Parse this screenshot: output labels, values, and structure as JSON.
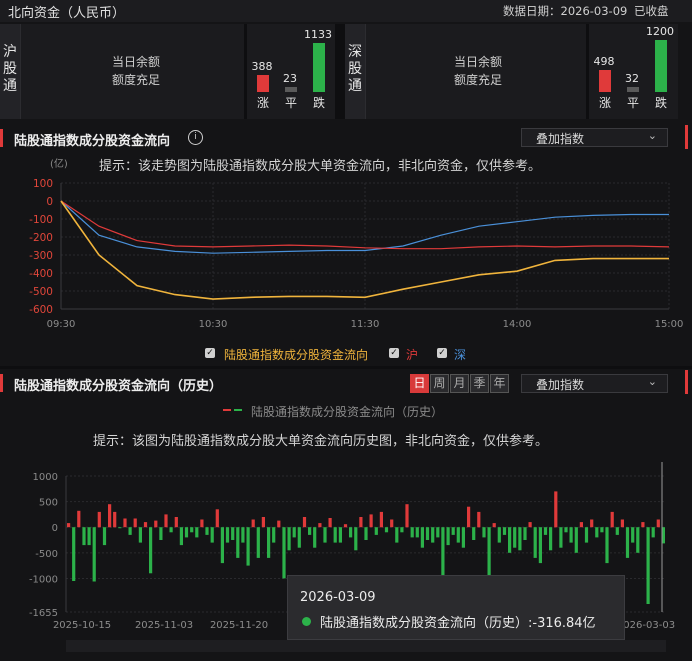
{
  "header": {
    "title": "北向资金（人民币）",
    "date_label": "数据日期：2026-03-09",
    "status": "已收盘"
  },
  "sh": {
    "name_chars": [
      "沪",
      "股",
      "通"
    ],
    "quota_title": "当日余额",
    "quota_status": "额度充足",
    "up": 388,
    "flat": 23,
    "down": 1133,
    "up_label": "涨",
    "flat_label": "平",
    "down_label": "跌"
  },
  "sz": {
    "name_chars": [
      "深",
      "股",
      "通"
    ],
    "quota_title": "当日余额",
    "quota_status": "额度充足",
    "up": 498,
    "flat": 32,
    "down": 1200,
    "up_label": "涨",
    "flat_label": "平",
    "down_label": "跌"
  },
  "intraday": {
    "title": "陆股通指数成分股资金流向",
    "info_icon": "info-icon",
    "dropdown": "叠加指数",
    "hint": "提示：该走势图为陆股通指数成分股大单资金流向，非北向资金，仅供参考。",
    "unit": "(亿)",
    "legend": [
      {
        "label": "陆股通指数成分股资金流向",
        "color": "#f0b43c"
      },
      {
        "label": "沪",
        "color": "#e03a3a"
      },
      {
        "label": "深",
        "color": "#4a90d9"
      }
    ]
  },
  "history": {
    "title": "陆股通指数成分股资金流向（历史）",
    "period_buttons": [
      "日",
      "周",
      "月",
      "季",
      "年"
    ],
    "active_period": 0,
    "dropdown": "叠加指数",
    "legend_label": "陆股通指数成分股资金流向（历史）",
    "hint": "提示：该图为陆股通指数成分股大单资金流向历史图，非北向资金，仅供参考。",
    "tooltip_date": "2026-03-09",
    "tooltip_text": "陆股通指数成分股资金流向（历史）:-316.84亿"
  },
  "colors": {
    "up": "#e03a3a",
    "down": "#2cb24a",
    "total": "#f0b43c",
    "sh": "#e03a3a",
    "sz": "#4a90d9",
    "axis_red": "#e0463a"
  },
  "chart_data": [
    {
      "type": "line",
      "title": "陆股通指数成分股资金流向",
      "ylabel": "(亿)",
      "x": [
        "09:30",
        "09:45",
        "10:00",
        "10:15",
        "10:30",
        "10:45",
        "11:00",
        "11:15",
        "11:30",
        "13:15",
        "13:30",
        "13:45",
        "14:00",
        "14:15",
        "14:30",
        "14:45",
        "15:00"
      ],
      "xticks": [
        "09:30",
        "10:30",
        "11:30",
        "14:00",
        "15:00"
      ],
      "yticks": [
        100,
        0,
        -100,
        -200,
        -300,
        -400,
        -500,
        -600
      ],
      "ylim": [
        -600,
        100
      ],
      "series": [
        {
          "name": "陆股通指数成分股资金流向",
          "values": [
            0,
            -300,
            -470,
            -520,
            -545,
            -535,
            -530,
            -530,
            -535,
            -490,
            -450,
            -410,
            -390,
            -330,
            -320,
            -320,
            -320
          ]
        },
        {
          "name": "沪",
          "values": [
            0,
            -140,
            -220,
            -250,
            -255,
            -250,
            -245,
            -250,
            -260,
            -265,
            -265,
            -255,
            -250,
            -255,
            -250,
            -250,
            -255
          ]
        },
        {
          "name": "深",
          "values": [
            0,
            -190,
            -255,
            -280,
            -290,
            -285,
            -280,
            -275,
            -275,
            -250,
            -190,
            -140,
            -115,
            -90,
            -80,
            -75,
            -75
          ]
        }
      ],
      "grid": true
    },
    {
      "type": "bar",
      "title": "陆股通指数成分股资金流向（历史）",
      "yticks": [
        1000,
        500,
        0,
        -500,
        -1000,
        -1655
      ],
      "ylim": [
        -1655,
        1000
      ],
      "xticks": [
        "2025-10-15",
        "2025-11-03",
        "2025-11-20",
        "2026-03-03"
      ],
      "values": [
        80,
        -1050,
        320,
        -350,
        -350,
        -1060,
        300,
        -350,
        450,
        300,
        -1,
        170,
        -150,
        170,
        -300,
        100,
        -900,
        130,
        -250,
        250,
        -100,
        200,
        -350,
        -200,
        -100,
        -200,
        150,
        -150,
        -300,
        350,
        -700,
        -300,
        -250,
        -600,
        -300,
        -750,
        150,
        -600,
        200,
        -600,
        -300,
        130,
        -1000,
        -450,
        -200,
        -400,
        200,
        -150,
        -400,
        80,
        -300,
        180,
        -300,
        -300,
        60,
        -200,
        -450,
        200,
        -250,
        250,
        -150,
        300,
        -100,
        150,
        -300,
        -100,
        450,
        -200,
        -200,
        -400,
        -250,
        -300,
        -200,
        -1200,
        -350,
        -150,
        -300,
        -400,
        400,
        -250,
        300,
        -200,
        -1100,
        80,
        -300,
        -150,
        -500,
        -400,
        -450,
        -250,
        100,
        -600,
        -700,
        -150,
        -450,
        700,
        -400,
        -100,
        -300,
        -500,
        100,
        -300,
        150,
        -200,
        -100,
        -700,
        300,
        -150,
        150,
        -600,
        -300,
        -500,
        100,
        -1500,
        -200,
        150,
        -317
      ]
    }
  ]
}
